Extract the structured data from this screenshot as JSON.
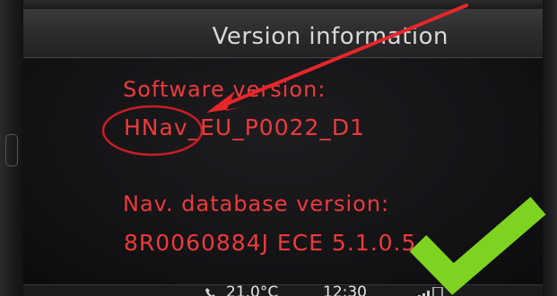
{
  "screen": {
    "title": "Version information"
  },
  "software": {
    "label": "Software version:",
    "value": "HNav_EU_P0022_D1"
  },
  "database": {
    "label": "Nav. database version:",
    "value": "8R0060884J  ECE 5.1.0.5"
  },
  "status_bar": {
    "temperature": "21.0°C",
    "time": "12:30"
  },
  "annotations": {
    "arrow_color": "#e8262a",
    "circle_color": "#c81e24",
    "checkmark_color": "#7ed321"
  },
  "icons": {
    "phone": "phone-icon",
    "signal": "signal-icon"
  }
}
